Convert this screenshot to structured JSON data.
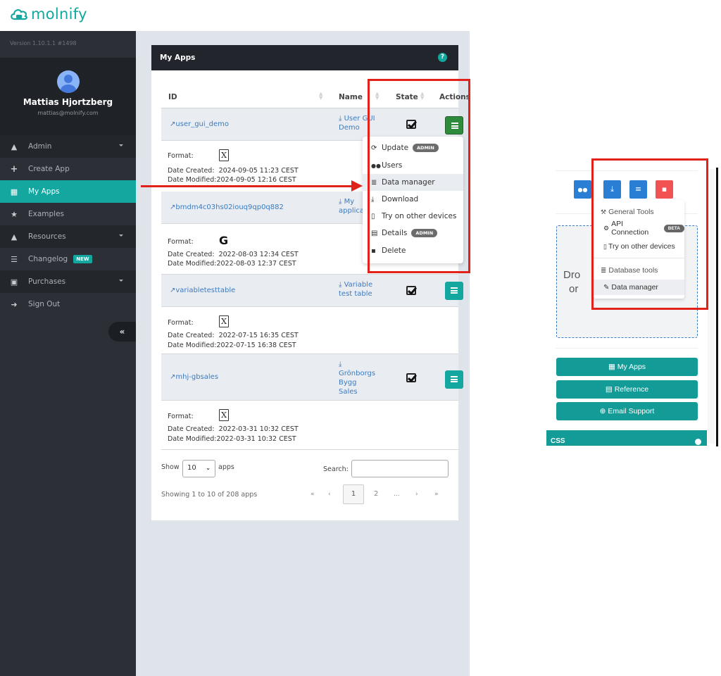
{
  "brand": {
    "name": "molnify",
    "color": "#13a7a0"
  },
  "sidebar": {
    "version": "Version 1.10.1.1 #1498",
    "user": {
      "name": "Mattias Hjortzberg",
      "email": "mattias@molnify.com"
    },
    "items": [
      {
        "label": "Admin",
        "icon": "user-secret-icon",
        "has_caret": true
      },
      {
        "label": "Create App",
        "icon": "plus-icon"
      },
      {
        "label": "My Apps",
        "icon": "grid-icon",
        "active": true
      },
      {
        "label": "Examples",
        "icon": "star-icon"
      },
      {
        "label": "Resources",
        "icon": "graduation-cap-icon",
        "has_caret": true
      },
      {
        "label": "Changelog",
        "icon": "list-icon",
        "badge": "NEW"
      },
      {
        "label": "Purchases",
        "icon": "cart-icon",
        "has_caret": true
      },
      {
        "label": "Sign Out",
        "icon": "sign-out-icon"
      }
    ],
    "collapse_label": "«"
  },
  "panel": {
    "title": "My Apps",
    "help_icon": "?",
    "columns": [
      "ID",
      "Name",
      "State",
      "Actions"
    ],
    "rows": [
      {
        "id": "user_gui_demo",
        "name_line1": "User GUI",
        "name_line2": "Demo",
        "format_icon": "X",
        "format_label": "Format:",
        "created_label": "Date Created:",
        "created": "2024-09-05 11:23 CEST",
        "modified_label": "Date Modified:",
        "modified": "2024-09-05 12:16 CEST"
      },
      {
        "id": "bmdm4c03hs02iouq9qp0q882",
        "name_line1": "My",
        "name_line2": "applica",
        "format_icon": "G",
        "format_label": "Format:",
        "created_label": "Date Created:",
        "created": "2022-08-03 12:34 CEST",
        "modified_label": "Date Modified:",
        "modified": "2022-08-03 12:37 CEST"
      },
      {
        "id": "variabletesttable",
        "name_line1": "Variable",
        "name_line2": "test table",
        "format_icon": "X",
        "format_label": "Format:",
        "created_label": "Date Created:",
        "created": "2022-07-15 16:35 CEST",
        "modified_label": "Date Modified:",
        "modified": "2022-07-15 16:38 CEST"
      },
      {
        "id": "mhj-gbsales",
        "name_line1": "Grönborgs",
        "name_line2": "Bygg Sales",
        "format_icon": "X",
        "format_label": "Format:",
        "created_label": "Date Created:",
        "created": "2022-03-31 10:32 CEST",
        "modified_label": "Date Modified:",
        "modified": "2022-03-31 10:32 CEST"
      }
    ],
    "dropdown": [
      {
        "label": "Update",
        "icon": "refresh-icon",
        "glyph": "⟳",
        "badge": "ADMIN"
      },
      {
        "label": "Users",
        "icon": "users-icon",
        "glyph": "👥"
      },
      {
        "label": "Data manager",
        "icon": "database-icon",
        "glyph": "≣",
        "highlighted": true
      },
      {
        "label": "Download",
        "icon": "download-icon",
        "glyph": "⤓"
      },
      {
        "label": "Try on other devices",
        "icon": "mobile-icon",
        "glyph": "▯"
      },
      {
        "label": "Details",
        "icon": "file-chart-icon",
        "glyph": "▤",
        "badge": "ADMIN"
      },
      {
        "label": "Delete",
        "icon": "trash-icon",
        "glyph": "🗑"
      }
    ],
    "footer": {
      "show_label": "Show",
      "page_size": "10",
      "apps_label": "apps",
      "search_label": "Search:",
      "search_value": "",
      "summary": "Showing 1 to 10 of 208 apps",
      "pager": {
        "first": "«",
        "prev": "‹",
        "current": "1",
        "next_page": "2",
        "ellipsis": "...",
        "next": "›",
        "last": "»"
      }
    }
  },
  "right_panel": {
    "toolbar_buttons": [
      {
        "icon": "users-icon",
        "glyph": "👥"
      },
      {
        "icon": "download-icon",
        "glyph": "⤓"
      },
      {
        "icon": "menu-icon",
        "glyph": "≡"
      },
      {
        "icon": "trash-icon",
        "glyph": "🗑"
      }
    ],
    "dropzone_text_line1": "Dro",
    "dropzone_text_line2": "or",
    "dropdown": [
      {
        "label": "General Tools",
        "icon": "wrench-icon",
        "glyph": "🔧",
        "header": true
      },
      {
        "label": "API Connection",
        "icon": "cogs-icon",
        "glyph": "⚙",
        "badge": "BETA"
      },
      {
        "label": "Try on other devices",
        "icon": "mobile-icon",
        "glyph": "▯"
      },
      {
        "label": "Database tools",
        "icon": "database-icon",
        "glyph": "≣",
        "header": true
      },
      {
        "label": "Data manager",
        "icon": "edit-icon",
        "glyph": "✎",
        "highlighted": true
      }
    ],
    "buttons": [
      {
        "label": "My Apps",
        "icon": "grid-icon",
        "glyph": "▦"
      },
      {
        "label": "Reference",
        "icon": "file-icon",
        "glyph": "▤"
      },
      {
        "label": "Email Support",
        "icon": "life-ring-icon",
        "glyph": "⊕"
      }
    ],
    "section_label": "CSS"
  },
  "annotation_color": "#e0221b"
}
